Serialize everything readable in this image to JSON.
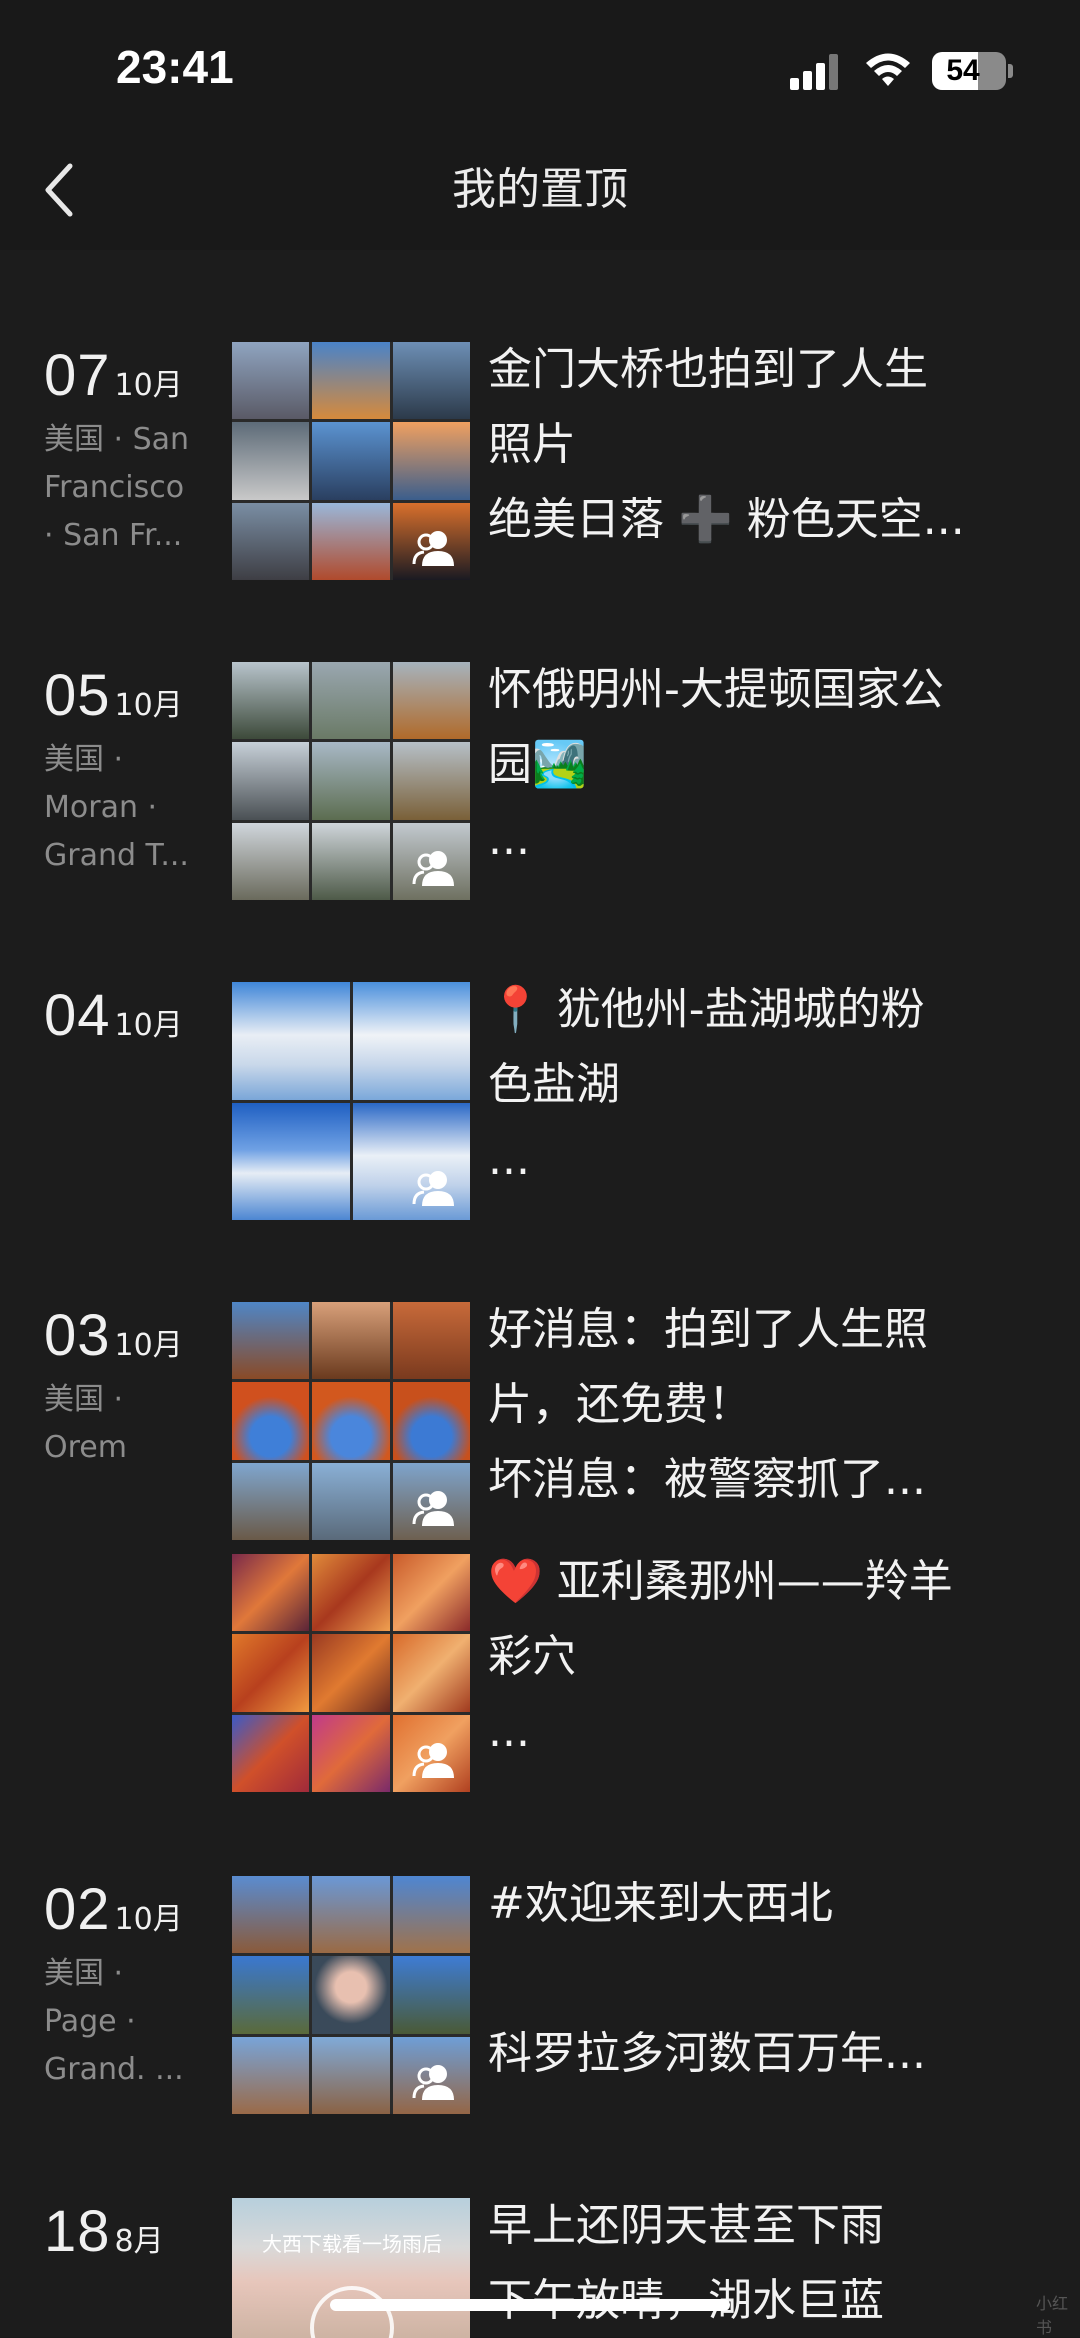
{
  "status": {
    "time": "23:41",
    "battery": "54"
  },
  "nav": {
    "title": "我的置顶"
  },
  "entries": [
    {
      "day": "07",
      "month": "10月",
      "location": [
        "美国 · San",
        "Francisco",
        "· San Fr..."
      ],
      "lines": [
        "金门大桥也拍到了人生",
        "照片",
        "绝美日落 ➕ 粉色天空..."
      ]
    },
    {
      "day": "05",
      "month": "10月",
      "location": [
        "美国 ·",
        "Moran ·",
        "Grand T..."
      ],
      "lines": [
        "怀俄明州-大提顿国家公",
        "园🏞️",
        "..."
      ]
    },
    {
      "day": "04",
      "month": "10月",
      "location": [],
      "lines": [
        "📍 犹他州-盐湖城的粉",
        "色盐湖",
        "..."
      ]
    },
    {
      "day": "03",
      "month": "10月",
      "location": [
        "美国 ·",
        "Orem"
      ],
      "lines": [
        "好消息：拍到了人生照",
        "片，还免费！",
        "坏消息：被警察抓了..."
      ]
    },
    {
      "day": "",
      "month": "",
      "location": [],
      "lines": [
        "❤️ 亚利桑那州——羚羊",
        "彩穴",
        "..."
      ]
    },
    {
      "day": "02",
      "month": "10月",
      "location": [
        "美国 ·",
        "Page ·",
        "Grand. ..."
      ],
      "lines": [
        "#欢迎来到大西北",
        "",
        "科罗拉多河数百万年..."
      ]
    },
    {
      "day": "18",
      "month": "8月",
      "location": [],
      "lines": [
        "早上还阴天甚至下雨",
        "下午放晴，湖水巨蓝"
      ]
    }
  ],
  "video_caption": "大西下载看一场雨后",
  "icons": {
    "back": "chevron-left-icon",
    "multi_photo": "people-icon",
    "signal": "signal-icon",
    "wifi": "wifi-icon",
    "battery": "battery-icon",
    "play": "play-icon"
  },
  "watermark": "小红书"
}
